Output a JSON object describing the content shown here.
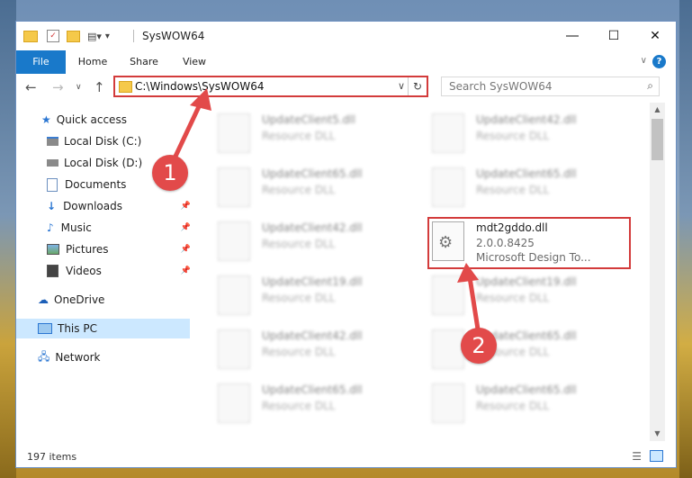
{
  "window": {
    "title": "SysWOW64"
  },
  "ribbon": {
    "tabs": [
      "File",
      "Home",
      "Share",
      "View"
    ]
  },
  "address": {
    "path": "C:\\Windows\\SysWOW64",
    "search_placeholder": "Search SysWOW64"
  },
  "nav": {
    "items": [
      {
        "label": "Quick access"
      },
      {
        "label": "Local Disk (C:)"
      },
      {
        "label": "Local Disk (D:)"
      },
      {
        "label": "Documents"
      },
      {
        "label": "Downloads"
      },
      {
        "label": "Music"
      },
      {
        "label": "Pictures"
      },
      {
        "label": "Videos"
      },
      {
        "label": "OneDrive"
      },
      {
        "label": "This PC"
      },
      {
        "label": "Network"
      }
    ]
  },
  "files": [
    {
      "name": "UpdateClient5.dll",
      "sub": "Resource DLL"
    },
    {
      "name": "UpdateClient42.dll",
      "sub": "Resource DLL"
    },
    {
      "name": "UpdateClient65.dll",
      "sub": "Resource DLL"
    },
    {
      "name": "UpdateClient65.dll",
      "sub": "Resource DLL"
    },
    {
      "name": "UpdateClient42.dll",
      "sub": "Resource DLL"
    },
    {
      "name": "mdt2gddo.dll",
      "sub": "2.0.0.8425",
      "sub2": "Microsoft Design To..."
    },
    {
      "name": "UpdateClient19.dll",
      "sub": "Resource DLL"
    },
    {
      "name": "UpdateClient19.dll",
      "sub": "Resource DLL"
    },
    {
      "name": "UpdateClient42.dll",
      "sub": "Resource DLL"
    },
    {
      "name": "UpdateClient65.dll",
      "sub": "Resource DLL"
    },
    {
      "name": "UpdateClient65.dll",
      "sub": "Resource DLL"
    },
    {
      "name": "UpdateClient65.dll",
      "sub": "Resource DLL"
    }
  ],
  "status": {
    "count": "197 items"
  },
  "annotations": {
    "step1": "1",
    "step2": "2"
  },
  "colors": {
    "accent": "#1979ca",
    "highlight": "#d33b3b",
    "selection": "#cce8ff"
  }
}
